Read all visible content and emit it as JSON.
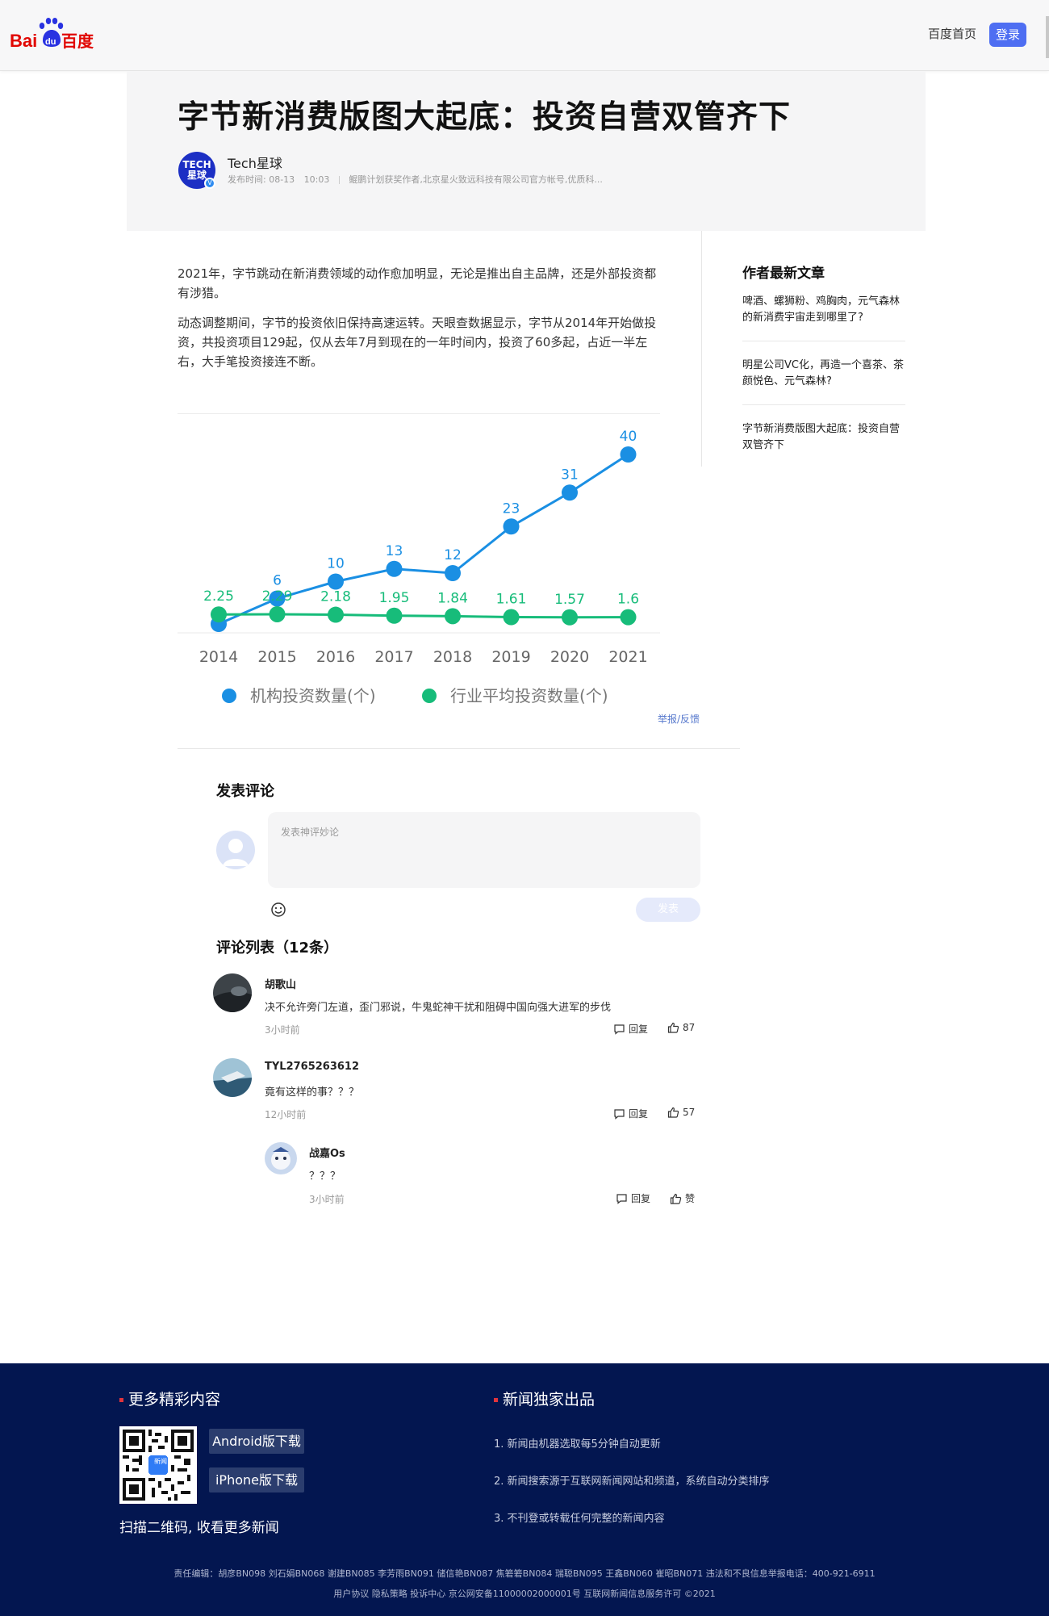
{
  "header": {
    "logo_text_latin": "Bai",
    "logo_text_du": "du",
    "logo_text_cn": "百度",
    "home_link": "百度首页",
    "login_button": "登录"
  },
  "article": {
    "title": "字节新消费版图大起底：投资自营双管齐下",
    "author": {
      "name": "Tech星球",
      "avatar_text": "TECH 星球",
      "publish_time": "发布时间: 08-13",
      "publish_clock": "10:03",
      "description": "鲲鹏计划获奖作者,北京星火致远科技有限公司官方帐号,优质科..."
    },
    "paragraphs": [
      "2021年，字节跳动在新消费领域的动作愈加明显，无论是推出自主品牌，还是外部投资都有涉猎。",
      "动态调整期间，字节的投资依旧保持高速运转。天眼查数据显示，字节从2014年开始做投资，共投资项目129起，仅从去年7月到现在的一年时间内，投资了60多起，占近一半左右，大手笔投资接连不断。"
    ],
    "report_link": "举报/反馈"
  },
  "sidebar": {
    "title": "作者最新文章",
    "items": [
      {
        "label": "啤酒、螺狮粉、鸡胸肉，元气森林的新消费宇宙走到哪里了?"
      },
      {
        "label": "明星公司VC化，再造一个喜茶、茶颜悦色、元气森林?"
      },
      {
        "label": "字节新消费版图大起底：投资自营双管齐下"
      }
    ]
  },
  "chart_data": {
    "type": "line",
    "title": "",
    "xlabel": "",
    "ylabel": "",
    "x": [
      "2014",
      "2015",
      "2016",
      "2017",
      "2018",
      "2019",
      "2020",
      "2021"
    ],
    "series": [
      {
        "name": "机构投资数量(个)",
        "color": "#1a8fe3",
        "values": [
          0,
          6,
          10,
          13,
          12,
          23,
          31,
          40
        ],
        "labels": [
          "",
          "6",
          "10",
          "13",
          "12",
          "23",
          "31",
          "40"
        ]
      },
      {
        "name": "行业平均投资数量(个)",
        "color": "#17bc7a",
        "values": [
          2.25,
          2.29,
          2.18,
          1.95,
          1.84,
          1.61,
          1.57,
          1.6
        ],
        "labels": [
          "2.25",
          "2.29",
          "2.18",
          "1.95",
          "1.84",
          "1.61",
          "1.57",
          "1.6"
        ]
      }
    ],
    "ylim": [
      0,
      40
    ],
    "grid": false,
    "legend": "bottom"
  },
  "comments": {
    "heading": "发表评论",
    "placeholder": "发表神评妙论",
    "publish_button": "发表",
    "list_heading": "评论列表（12条）",
    "reply_label": "回复",
    "items": [
      {
        "name": "胡歌山",
        "text": "决不允许旁门左道，歪门邪说，牛鬼蛇神干扰和阻碍中国向强大进军的步伐",
        "time": "3小时前",
        "likes": "87"
      },
      {
        "name": "TYL2765263612",
        "text": "竟有这样的事？？？",
        "time": "12小时前",
        "likes": "57"
      },
      {
        "name": "战嘉Os",
        "text": "？？？",
        "time": "3小时前",
        "likes": "赞"
      }
    ]
  },
  "footer": {
    "more_heading": "更多精彩内容",
    "qr_label": "新闻",
    "android_button": "Android版下载",
    "iphone_button": "iPhone版下载",
    "qr_caption": "扫描二维码, 收看更多新闻",
    "exclusive_heading": "新闻独家出品",
    "notes": [
      "1. 新闻由机器选取每5分钟自动更新",
      "2. 新闻搜索源于互联网新闻网站和频道，系统自动分类排序",
      "3. 不刊登或转载任何完整的新闻内容"
    ],
    "editors": "责任编辑：胡彦BN098 刘石娟BN068 谢建BN085 李芳雨BN091 储信艳BN087 焦箬箬BN084 瑞聪BN095 王鑫BN060 崔昭BN071 违法和不良信息举报电话：400-921-6911",
    "legal": "用户协议 隐私策略 投诉中心 京公网安备11000002000001号 互联网新闻信息服务许可 ©2021"
  }
}
